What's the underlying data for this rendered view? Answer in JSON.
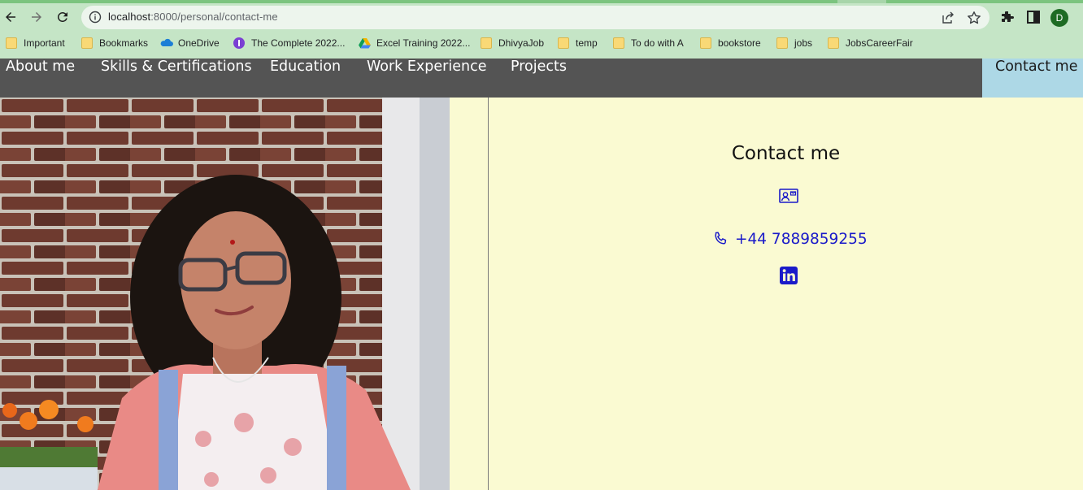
{
  "browser": {
    "url_host": "localhost",
    "url_rest": ":8000/personal/contact-me",
    "profile_initial": "D",
    "bookmarks": [
      {
        "label": "Important",
        "icon": "folder-icon"
      },
      {
        "label": "Bookmarks",
        "icon": "folder-icon"
      },
      {
        "label": "OneDrive",
        "icon": "onedrive-icon"
      },
      {
        "label": "The Complete 2022...",
        "icon": "purple-circle-icon"
      },
      {
        "label": "Excel Training 2022...",
        "icon": "google-drive-icon"
      },
      {
        "label": "DhivyaJob",
        "icon": "folder-icon"
      },
      {
        "label": "temp",
        "icon": "folder-icon"
      },
      {
        "label": "To do with A",
        "icon": "folder-icon"
      },
      {
        "label": "bookstore",
        "icon": "folder-icon"
      },
      {
        "label": "jobs",
        "icon": "folder-icon"
      },
      {
        "label": "JobsCareerFair",
        "icon": "folder-icon"
      }
    ]
  },
  "nav": {
    "items": [
      {
        "label": "About me",
        "active": false
      },
      {
        "label": "Skills & Certifications",
        "active": false
      },
      {
        "label": "Education",
        "active": false
      },
      {
        "label": "Work Experience",
        "active": false
      },
      {
        "label": "Projects",
        "active": false
      },
      {
        "label": "Contact me",
        "active": true
      }
    ]
  },
  "contact": {
    "title": "Contact me",
    "phone": "+44 7889859255",
    "icons": [
      "contact-card-icon",
      "phone-icon",
      "linkedin-icon"
    ]
  },
  "colors": {
    "nav_bg": "#545454",
    "nav_active_bg": "#add8e6",
    "content_bg": "#fafad2",
    "link": "#1a1ac9",
    "chrome_bg": "#c5e5c6"
  }
}
